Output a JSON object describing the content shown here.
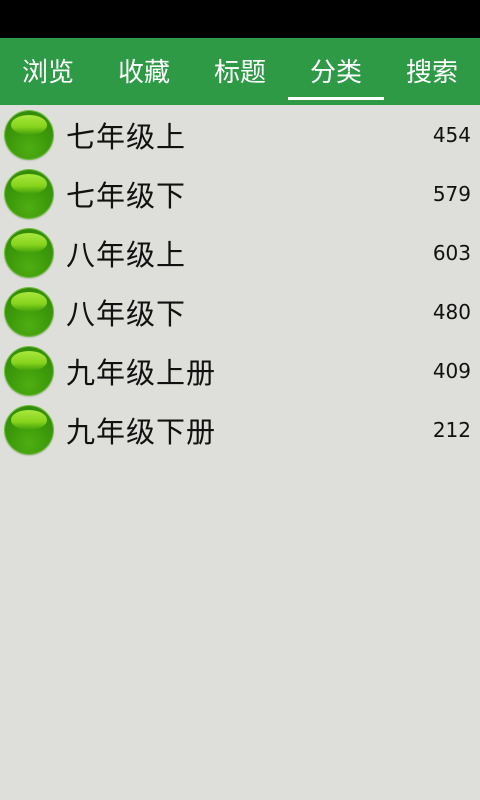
{
  "tabs": [
    {
      "label": "浏览",
      "active": false
    },
    {
      "label": "收藏",
      "active": false
    },
    {
      "label": "标题",
      "active": false
    },
    {
      "label": "分类",
      "active": true
    },
    {
      "label": "搜索",
      "active": false
    }
  ],
  "categories": [
    {
      "label": "七年级上",
      "count": "454"
    },
    {
      "label": "七年级下",
      "count": "579"
    },
    {
      "label": "八年级上",
      "count": "603"
    },
    {
      "label": "八年级下",
      "count": "480"
    },
    {
      "label": "九年级上册",
      "count": "409"
    },
    {
      "label": "九年级下册",
      "count": "212"
    }
  ],
  "colors": {
    "tab_bar": "#2e9a46",
    "background": "#dededa",
    "status_bar": "#000000",
    "ball": "#5cc015"
  }
}
